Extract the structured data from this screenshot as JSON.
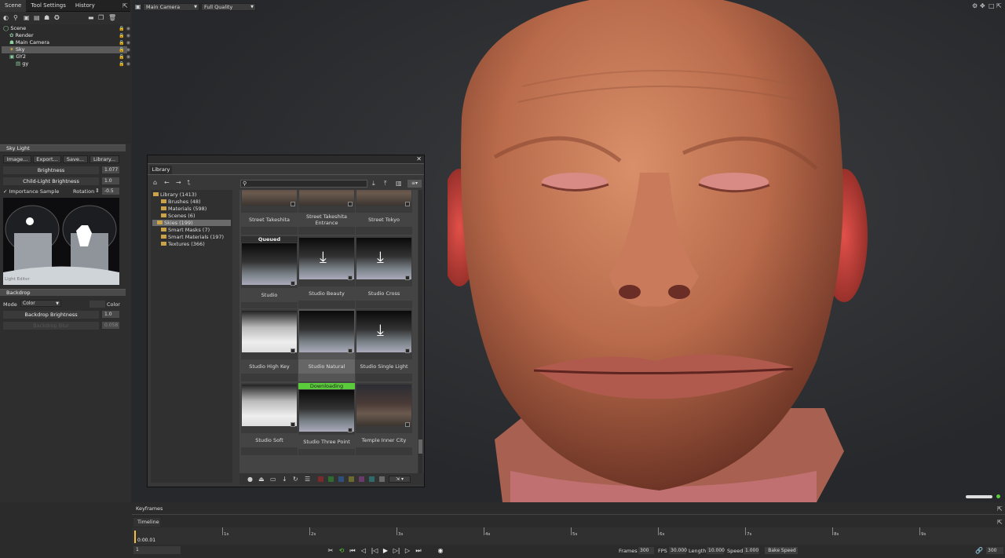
{
  "left_panel": {
    "tabs": [
      "Scene",
      "Tool Settings",
      "History"
    ],
    "tree": [
      {
        "label": "Scene",
        "indent": 0,
        "selected": false
      },
      {
        "label": "Render",
        "indent": 1,
        "selected": false
      },
      {
        "label": "Main Camera",
        "indent": 1,
        "selected": false
      },
      {
        "label": "Sky",
        "indent": 1,
        "selected": true
      },
      {
        "label": "GY2",
        "indent": 1,
        "selected": false
      },
      {
        "label": "gy",
        "indent": 2,
        "selected": false
      }
    ],
    "sky_light": {
      "header": "Sky Light",
      "buttons": [
        "Image...",
        "Export...",
        "Save...",
        "Library..."
      ],
      "brightness_label": "Brightness",
      "brightness_value": "1.077",
      "child_light_label": "Child-Light Brightness",
      "child_light_value": "1.0",
      "importance_sample_label": "Importance Sample",
      "rotation_label": "Rotation",
      "rotation_value": "-0.5",
      "preview_caption": "Light Editor"
    },
    "backdrop": {
      "header": "Backdrop",
      "mode_label": "Mode",
      "mode_value": "Color",
      "color_label": "Color",
      "brightness_label": "Backdrop Brightness",
      "brightness_value": "1.0",
      "blur_label": "Backdrop Blur",
      "blur_value": "0.058"
    }
  },
  "viewport": {
    "camera": "Main Camera",
    "quality": "Full Quality"
  },
  "library": {
    "tab": "Library",
    "folders": [
      {
        "label": "Library (1413)",
        "root": true,
        "selected": false
      },
      {
        "label": "Brushes (48)",
        "root": false,
        "selected": false
      },
      {
        "label": "Materials (598)",
        "root": false,
        "selected": false
      },
      {
        "label": "Scenes (6)",
        "root": false,
        "selected": false
      },
      {
        "label": "Skies (199)",
        "root": false,
        "selected": true
      },
      {
        "label": "Smart Masks (7)",
        "root": false,
        "selected": false
      },
      {
        "label": "Smart Materials (197)",
        "root": false,
        "selected": false
      },
      {
        "label": "Textures (366)",
        "root": false,
        "selected": false
      }
    ],
    "items": [
      {
        "name": "Street Takeshita",
        "badge": "",
        "selected": false
      },
      {
        "name": "Street Takeshita Entrance",
        "badge": "",
        "selected": false
      },
      {
        "name": "Street Tokyo",
        "badge": "",
        "selected": false
      },
      {
        "name": "Studio",
        "badge": "Queued",
        "selected": false
      },
      {
        "name": "Studio Beauty",
        "badge": "",
        "selected": false
      },
      {
        "name": "Studio Cross",
        "badge": "",
        "selected": false
      },
      {
        "name": "Studio High Key",
        "badge": "",
        "selected": false
      },
      {
        "name": "Studio Natural",
        "badge": "",
        "selected": true
      },
      {
        "name": "Studio Single Light",
        "badge": "",
        "selected": false
      },
      {
        "name": "Studio Soft",
        "badge": "",
        "selected": false
      },
      {
        "name": "Studio Three Point",
        "badge": "Downloading",
        "selected": false
      },
      {
        "name": "Temple Inner City",
        "badge": "",
        "selected": false
      }
    ],
    "swatches": [
      "#7a2a2a",
      "#2f6a2f",
      "#2d4f7a",
      "#6a6a30",
      "#6a3a6a",
      "#2f6a6a",
      "#6a6a6a"
    ]
  },
  "timeline": {
    "keyframes_tab": "Keyframes",
    "timeline_tab": "Timeline",
    "current_time": "0:00.01",
    "frame_field": "1",
    "ticks": [
      "1s",
      "2s",
      "3s",
      "4s",
      "5s",
      "6s",
      "7s",
      "8s",
      "9s"
    ],
    "frames_label": "Frames",
    "frames_value": "300",
    "fps_label": "FPS",
    "fps_value": "30.000",
    "length_label": "Length",
    "length_value": "10.000",
    "speed_label": "Speed",
    "speed_value": "1.000",
    "bake_label": "Bake Speed",
    "end_value": "300"
  }
}
